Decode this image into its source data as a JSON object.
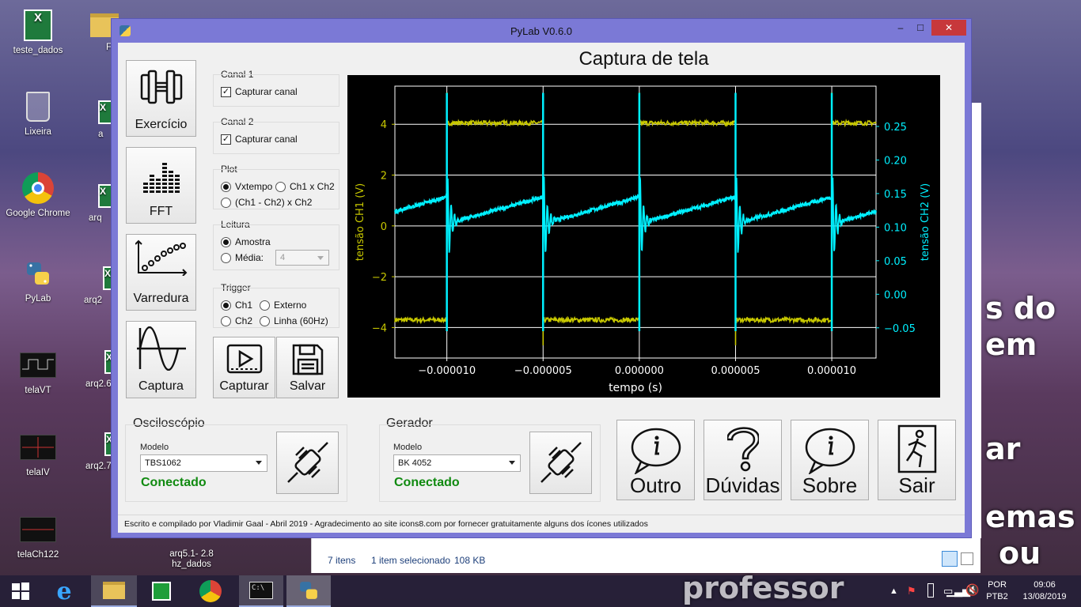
{
  "desktop": {
    "icons": [
      {
        "label": "teste_dados"
      },
      {
        "label": "F"
      },
      {
        "label": "Lixeira"
      },
      {
        "label": "a"
      },
      {
        "label": "Google Chrome"
      },
      {
        "label": "arq"
      },
      {
        "label": "PyLab"
      },
      {
        "label": "arq2"
      },
      {
        "label": "telaVT"
      },
      {
        "label": "arq2.6"
      },
      {
        "label": "telaIV"
      },
      {
        "label": "arq2.7"
      },
      {
        "label": "telaCh122"
      },
      {
        "label": "arq5.1- 2.8\nhz_dados"
      }
    ],
    "background_words": [
      "s do",
      "em",
      "ar",
      "emas",
      "ou",
      "professor"
    ]
  },
  "window": {
    "title": "PyLab V0.6.0",
    "controls": {
      "minimize": "–",
      "maximize": "□",
      "close": "✕"
    }
  },
  "sidebar": {
    "buttons": [
      {
        "label": "Exercício",
        "icon": "dumbbell-icon"
      },
      {
        "label": "FFT",
        "icon": "equalizer-icon"
      },
      {
        "label": "Varredura",
        "icon": "scatter-plot-icon"
      },
      {
        "label": "Captura",
        "icon": "sine-wave-icon"
      }
    ]
  },
  "controls": {
    "canal1": {
      "title": "Canal 1",
      "checkbox": "Capturar canal",
      "checked": true
    },
    "canal2": {
      "title": "Canal 2",
      "checkbox": "Capturar canal",
      "checked": true
    },
    "plot": {
      "title": "Plot",
      "opt1": "Vxtempo",
      "opt2": "Ch1 x Ch2",
      "opt3": "(Ch1 - Ch2) x Ch2",
      "selected": "Vxtempo"
    },
    "leitura": {
      "title": "Leitura",
      "opt1": "Amostra",
      "opt2": "Média:",
      "media_value": "4",
      "selected": "Amostra"
    },
    "trigger": {
      "title": "Trigger",
      "opt1": "Ch1",
      "opt2": "Externo",
      "opt3": "Ch2",
      "opt4": "Linha (60Hz)",
      "selected": "Ch1"
    },
    "capturar_label": "Capturar",
    "salvar_label": "Salvar"
  },
  "chart_title": "Captura de tela",
  "chart_data": {
    "type": "line",
    "xlabel": "tempo (s)",
    "ylabel_left": "tensão CH1 (V)",
    "ylabel_right": "tensão CH2 (V)",
    "xlim": [
      -1.27e-05,
      1.23e-05
    ],
    "ylim_left": [
      -5.2,
      5.5
    ],
    "ylim_right": [
      -0.095,
      0.31
    ],
    "x_ticks": [
      -1e-05,
      -5e-06,
      0.0,
      5e-06,
      1e-05
    ],
    "x_tick_labels": [
      "−0.000010",
      "−0.000005",
      "0.000000",
      "0.000005",
      "0.000010"
    ],
    "y_left_ticks": [
      4,
      2,
      0,
      -2,
      -4
    ],
    "y_left_tick_labels": [
      "4",
      "2",
      "0",
      "−2",
      "−4"
    ],
    "y_right_ticks": [
      0.25,
      0.2,
      0.15,
      0.1,
      0.05,
      0.0,
      -0.05
    ],
    "y_right_tick_labels": [
      "0.25",
      "0.20",
      "0.15",
      "0.10",
      "0.05",
      "0.00",
      "−0.05"
    ],
    "grid": true,
    "series": [
      {
        "name": "tensão CH1 (V)",
        "axis": "left",
        "color": "#c8c800",
        "kind": "square",
        "high": 4.05,
        "low": -3.7,
        "edges": [
          {
            "x": -1e-05,
            "to": "high"
          },
          {
            "x": -5e-06,
            "to": "low"
          },
          {
            "x": 0.0,
            "to": "high"
          },
          {
            "x": 5e-06,
            "to": "low"
          },
          {
            "x": 1e-05,
            "to": "high"
          }
        ]
      },
      {
        "name": "tensão CH2 (V)",
        "axis": "right",
        "color": "#00f0ff",
        "kind": "sawtooth",
        "spikes": [
          -1e-05,
          -5e-06,
          0.0,
          5e-06,
          1e-05
        ],
        "trough": 0.105,
        "peak": 0.145,
        "spike_top": 0.3,
        "spike_bottom": -0.055
      }
    ]
  },
  "osciloscopio": {
    "title": "Osciloscópio",
    "modelo_label": "Modelo",
    "modelo": "TBS1062",
    "status": "Conectado"
  },
  "gerador": {
    "title": "Gerador",
    "modelo_label": "Modelo",
    "modelo": "BK 4052",
    "status": "Conectado"
  },
  "actions": {
    "outro": "Outro",
    "duvidas": "Dúvidas",
    "sobre": "Sobre",
    "sair": "Sair"
  },
  "footer": "Escrito e compilado por Vladimir Gaal - Abril 2019 - Agradecimento ao site icons8.com por fornecer gratuitamente alguns dos ícones utilizados",
  "explorer_status": {
    "items": "7 itens",
    "selected": "1 item selecionado",
    "size": "108 KB"
  },
  "tray": {
    "lang1": "POR",
    "lang2": "PTB2",
    "time": "09:06",
    "date": "13/08/2019"
  },
  "colors": {
    "title_bar": "#7b79d6",
    "connected": "#108a10",
    "ch1": "#c8c800",
    "ch2": "#00f0ff",
    "close": "#c7383b"
  }
}
